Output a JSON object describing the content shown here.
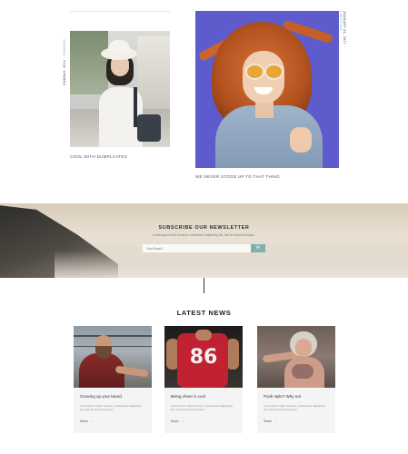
{
  "features": [
    {
      "vertical_tag": "SUNDAY, 2014",
      "vertical_accent": "FASHION",
      "caption": "COOL WITH DUMPLCATES",
      "image": "woman-in-white-hat-photo"
    },
    {
      "vertical_tag": "JANUARY 01, 2017",
      "vertical_accent": "LIFESTYLE",
      "caption": "WE NEVER STOOD UP TO THAT THING",
      "image": "red-haired-woman-sunglasses-photo"
    }
  ],
  "newsletter": {
    "title": "SUBSCRIBE OUR NEWSLETTER",
    "subtitle": "Lorem ipsum dolor sit amet, consectetur adipiscing elit, sed do eiusmod tempor.",
    "input_placeholder": "Your Email...",
    "button_icon": "send-icon",
    "button_glyph": "✉"
  },
  "latest_news": {
    "title": "LATEST NEWS",
    "cards": [
      {
        "title": "Growing up your beard",
        "excerpt": "Lorem ipsum dolor sit amet, consectetur adipiscing elit, sed do eiusmod tempor.",
        "more_label": "Share",
        "arrow": "›",
        "image": "bearded-man-photo"
      },
      {
        "title": "Being cheer is cool",
        "excerpt": "Lorem ipsum dolor sit amet, consectetur adipiscing elit, sed do eiusmod tempor.",
        "more_label": "Share",
        "arrow": "›",
        "image": "jersey-86-photo"
      },
      {
        "title": "Punk style? Why not",
        "excerpt": "Lorem ipsum dolor sit amet, consectetur adipiscing elit, sed do eiusmod tempor.",
        "more_label": "Share",
        "arrow": "›",
        "image": "tattooed-woman-photo"
      }
    ]
  },
  "colors": {
    "accent": "#7fb0ae",
    "heading": "#1f1f1f",
    "card_bg": "#f4f4f4"
  }
}
